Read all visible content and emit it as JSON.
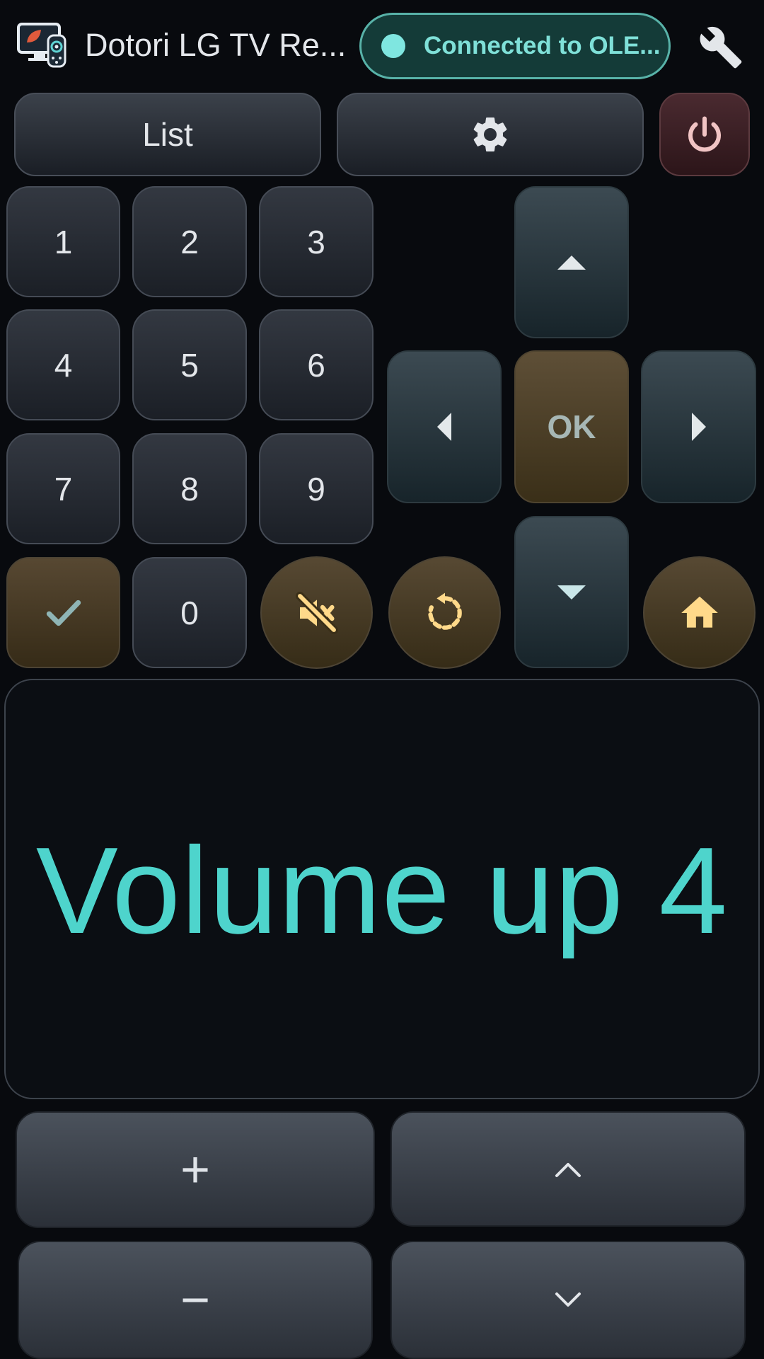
{
  "header": {
    "app_title": "Dotori LG TV Re...",
    "status_label": "Connected to OLE...",
    "icons": {
      "app": "app-logo-icon",
      "settings_tool": "wrench-icon",
      "status": "status-dot-icon"
    }
  },
  "toolbar": {
    "list_label": "List",
    "icons": {
      "settings": "gear-icon",
      "power": "power-icon"
    }
  },
  "keypad": {
    "keys": [
      "1",
      "2",
      "3",
      "4",
      "5",
      "6",
      "7",
      "8",
      "9",
      "0"
    ],
    "icons": {
      "confirm": "check-icon"
    }
  },
  "dpad": {
    "ok_label": "OK",
    "icons": {
      "up": "triangle-up-icon",
      "down": "triangle-down-icon",
      "left": "triangle-left-icon",
      "right": "triangle-right-icon"
    }
  },
  "actions": {
    "icons": {
      "mute": "mute-icon",
      "back": "back-icon",
      "home": "home-icon"
    }
  },
  "display": {
    "message": "Volume up 4"
  },
  "volume": {
    "plus_label": "+",
    "minus_label": "−",
    "icons": {
      "channel_up": "chevron-up-icon",
      "channel_down": "chevron-down-icon"
    }
  },
  "colors": {
    "accent": "#4ed4cc",
    "status_bg": "#143b38",
    "status_border": "#58b2a8",
    "gold_icon": "#ffd98a",
    "power_icon": "#f1c4c4"
  }
}
